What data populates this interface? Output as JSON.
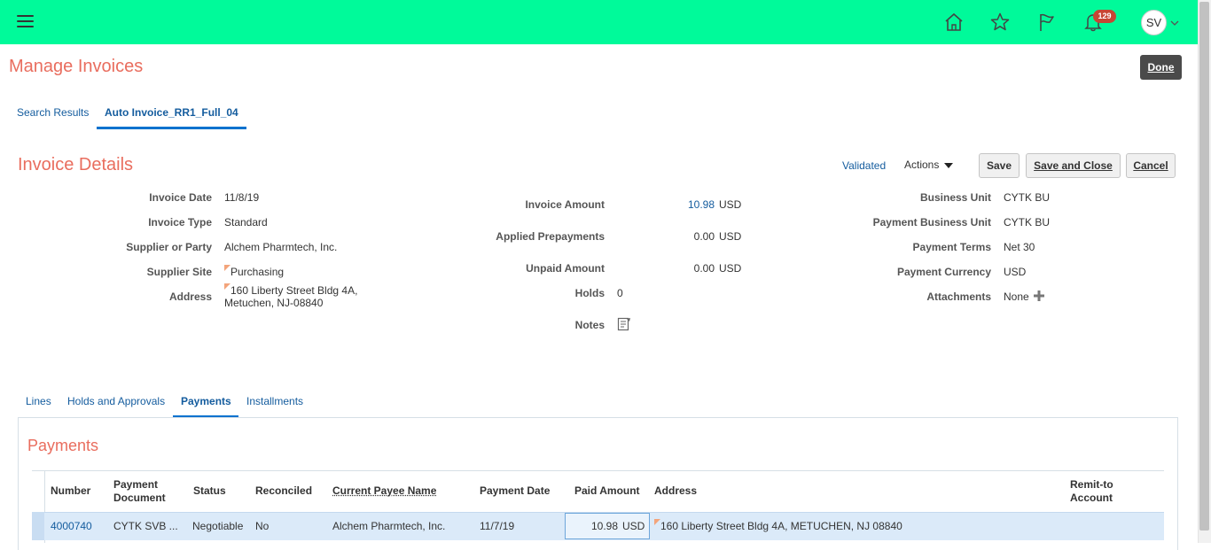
{
  "header": {
    "notification_count": "129",
    "user_initials": "SV",
    "colors": {
      "bar": "#00fa9a",
      "badge": "#c74634"
    },
    "icons": [
      "menu-icon",
      "home-icon",
      "favorites-star-icon",
      "flag-icon",
      "notifications-bell-icon",
      "chevron-down-icon"
    ]
  },
  "page": {
    "title": "Manage Invoices",
    "done_label": "Done"
  },
  "tabs": [
    {
      "label": "Search Results"
    },
    {
      "label": "Auto Invoice_RR1_Full_04",
      "active": true
    }
  ],
  "invoice": {
    "section_title": "Invoice Details",
    "status": "Validated",
    "actions_label": "Actions",
    "buttons": {
      "save": "Save",
      "save_close": "Save and Close",
      "cancel": "Cancel"
    },
    "left": [
      {
        "label": "Invoice Date",
        "value": "11/8/19"
      },
      {
        "label": "Invoice Type",
        "value": "Standard"
      },
      {
        "label": "Supplier or Party",
        "value": "Alchem Pharmtech, Inc."
      },
      {
        "label": "Supplier Site",
        "value": "Purchasing"
      },
      {
        "label": "Address",
        "value": "160 Liberty Street Bldg 4A,",
        "value2": "Metuchen, NJ-08840"
      }
    ],
    "middle": {
      "invoice_amount": {
        "label": "Invoice Amount",
        "value": "10.98",
        "currency": "USD"
      },
      "applied_prepayments": {
        "label": "Applied Prepayments",
        "value": "0.00",
        "currency": "USD"
      },
      "unpaid_amount": {
        "label": "Unpaid Amount",
        "value": "0.00",
        "currency": "USD"
      },
      "holds": {
        "label": "Holds",
        "value": "0"
      },
      "notes": {
        "label": "Notes"
      }
    },
    "right": [
      {
        "label": "Business Unit",
        "value": "CYTK BU"
      },
      {
        "label": "Payment Business Unit",
        "value": "CYTK BU"
      },
      {
        "label": "Payment Terms",
        "value": "Net 30"
      },
      {
        "label": "Payment Currency",
        "value": "USD"
      },
      {
        "label": "Attachments",
        "value": "None"
      }
    ]
  },
  "subtabs": [
    {
      "label": "Lines"
    },
    {
      "label": "Holds and Approvals"
    },
    {
      "label": "Payments",
      "active": true
    },
    {
      "label": "Installments"
    }
  ],
  "payments": {
    "title": "Payments",
    "columns": {
      "number": "Number",
      "payment_document_1": "Payment",
      "payment_document_2": "Document",
      "status": "Status",
      "reconciled": "Reconciled",
      "payee": "Current Payee Name",
      "payment_date": "Payment Date",
      "paid_amount": "Paid Amount",
      "address": "Address",
      "remit_1": "Remit-to",
      "remit_2": "Account"
    },
    "rows": [
      {
        "number": "4000740",
        "payment_document": "CYTK SVB ...",
        "status": "Negotiable",
        "reconciled": "No",
        "payee": "Alchem Pharmtech, Inc.",
        "payment_date": "11/7/19",
        "paid_amount": "10.98",
        "currency": "USD",
        "address": "160 Liberty Street Bldg 4A, METUCHEN, NJ 08840"
      }
    ]
  }
}
